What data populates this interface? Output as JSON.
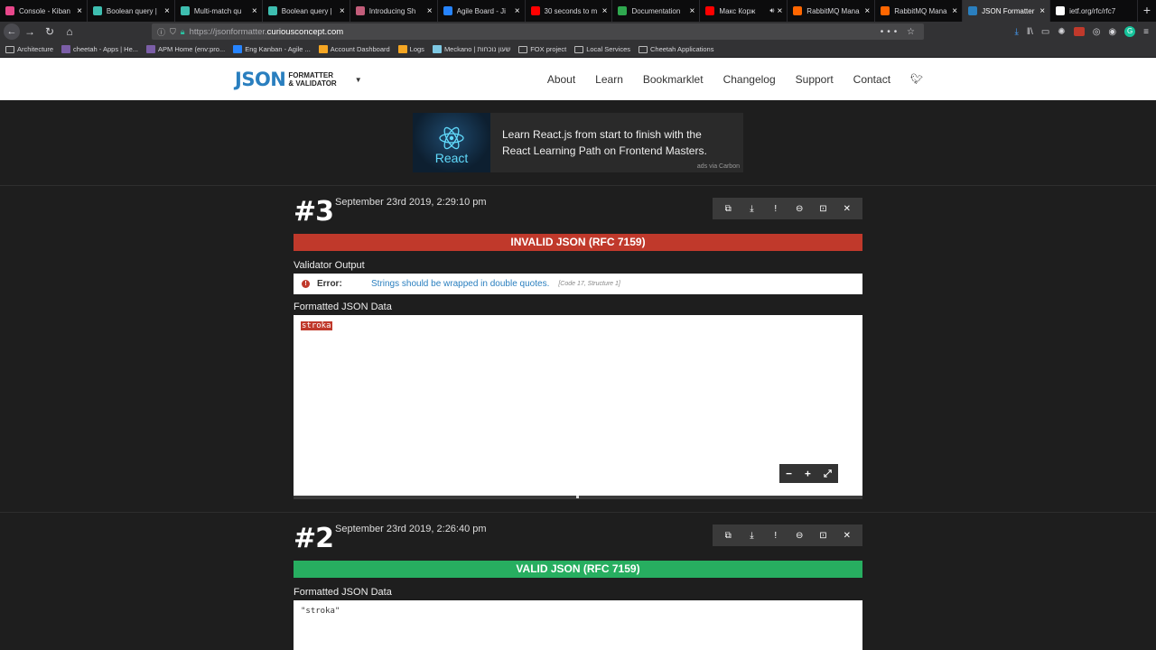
{
  "tabs": [
    {
      "label": "Console - Kiban",
      "color": "#e8478b"
    },
    {
      "label": "Boolean query |",
      "color": "#3ebeb0"
    },
    {
      "label": "Multi-match qu",
      "color": "#3ebeb0"
    },
    {
      "label": "Boolean query |",
      "color": "#3ebeb0"
    },
    {
      "label": "Introducing Sh",
      "color": "#c25d7a"
    },
    {
      "label": "Agile Board - Ji",
      "color": "#2684ff"
    },
    {
      "label": "30 seconds to m",
      "color": "#ff0000"
    },
    {
      "label": "Documentation",
      "color": "#2fa84f"
    },
    {
      "label": "Макс Корж",
      "color": "#ff0000"
    },
    {
      "label": "RabbitMQ Mana",
      "color": "#ff6600"
    },
    {
      "label": "RabbitMQ Mana",
      "color": "#ff6600"
    },
    {
      "label": "JSON Formatter",
      "color": "#2a7fbf"
    },
    {
      "label": "ietf.org/rfc/rfc7",
      "color": "#ffffff"
    }
  ],
  "url": {
    "prefix": "https://jsonformatter.",
    "domain": "curiousconcept.com"
  },
  "bookmarks": [
    {
      "label": "Architecture",
      "kind": "folder"
    },
    {
      "label": "cheetah - Apps | He...",
      "color": "#7b5ea7"
    },
    {
      "label": "APM Home (env:pro...",
      "color": "#7b5ea7"
    },
    {
      "label": "Eng Kanban - Agile ...",
      "color": "#2684ff"
    },
    {
      "label": "Account Dashboard",
      "color": "#f5a623"
    },
    {
      "label": "Logs",
      "color": "#f5a623"
    },
    {
      "label": "Meckano | שעון נוכחות",
      "color": "#7ec8e3"
    },
    {
      "label": "FOX project",
      "kind": "folder"
    },
    {
      "label": "Local Services",
      "kind": "folder"
    },
    {
      "label": "Cheetah Applications",
      "kind": "folder"
    }
  ],
  "logo": {
    "big": "JSON",
    "line1": "FORMATTER",
    "line2": "& VALIDATOR"
  },
  "nav": [
    "About",
    "Learn",
    "Bookmarklet",
    "Changelog",
    "Support",
    "Contact"
  ],
  "ad": {
    "brand": "React",
    "text": "Learn React.js from start to finish with the React Learning Path on Frontend Masters.",
    "via": "ads via Carbon"
  },
  "entries": [
    {
      "number": "#3",
      "date": "September 23rd 2019, 2:29:10 pm",
      "status": "INVALID JSON (RFC 7159)",
      "validator_label": "Validator Output",
      "error_label": "Error:",
      "error_message": "Strings should be wrapped in double quotes.",
      "error_code": "[Code 17, Structure 1]",
      "formatted_label": "Formatted JSON Data",
      "code": "stroka"
    },
    {
      "number": "#2",
      "date": "September 23rd 2019, 2:26:40 pm",
      "status": "VALID JSON (RFC 7159)",
      "formatted_label": "Formatted JSON Data",
      "code": "\"stroka\""
    }
  ]
}
